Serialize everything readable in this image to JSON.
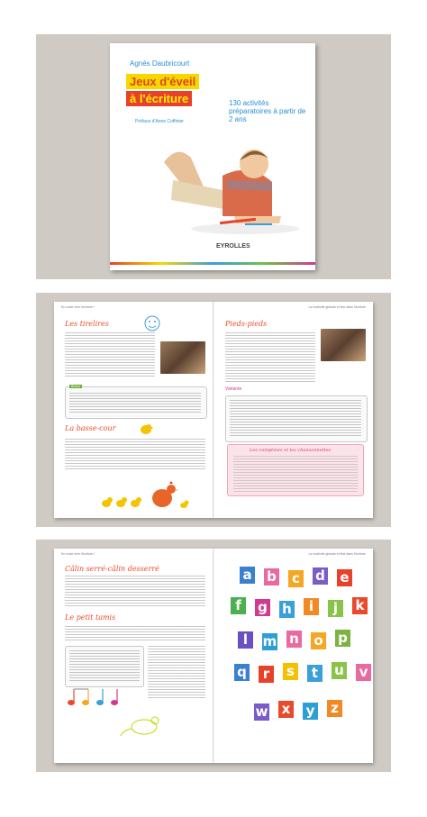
{
  "cover": {
    "author": "Agnès Daubricourt",
    "title_line1": "Jeux d'éveil",
    "title_line2": "à l'écriture",
    "subtitle": "130 activités préparatoires à partir de 2 ans",
    "preface": "Préface d'Anne Coffinier",
    "publisher": "EYROLLES"
  },
  "spread1": {
    "header_left": "En route vers l'écriture !",
    "header_right": "La motricité globale et fine dans l'écriture",
    "left_title": "Les tirelires",
    "left_box_tag": "Bonus",
    "left_title2": "La basse-cour",
    "right_title": "Pieds-pieds",
    "right_caption": "Variante",
    "pink_title": "Les comptines et les chansonnettes"
  },
  "spread2": {
    "header_left": "En route vers l'écriture !",
    "header_right": "La motricité globale et fine dans l'écriture",
    "left_title": "Câlin serré-câlin desserré",
    "left_title2": "Le petit tamis"
  },
  "letters": [
    "a",
    "b",
    "c",
    "d",
    "e",
    "f",
    "g",
    "h",
    "i",
    "j",
    "k",
    "l",
    "m",
    "n",
    "o",
    "p",
    "q",
    "r",
    "s",
    "t",
    "u",
    "v",
    "w",
    "x",
    "y",
    "z"
  ],
  "letter_colors": [
    "#3a7fd0",
    "#e86aa0",
    "#f5a623",
    "#7a5bc8",
    "#e8412a",
    "#4caf50",
    "#d23a8f",
    "#3aa0d8",
    "#f08a24",
    "#8bc34a",
    "#e84a2c",
    "#6d4fc4",
    "#2e9fd4",
    "#e86aa0",
    "#f5a623",
    "#7cb342",
    "#3a7fd0",
    "#e8412a",
    "#f2c200",
    "#3aa0d8",
    "#8bc34a",
    "#e86aa0",
    "#7a5bc8",
    "#e84a2c",
    "#2e9fd4",
    "#f08a24"
  ]
}
